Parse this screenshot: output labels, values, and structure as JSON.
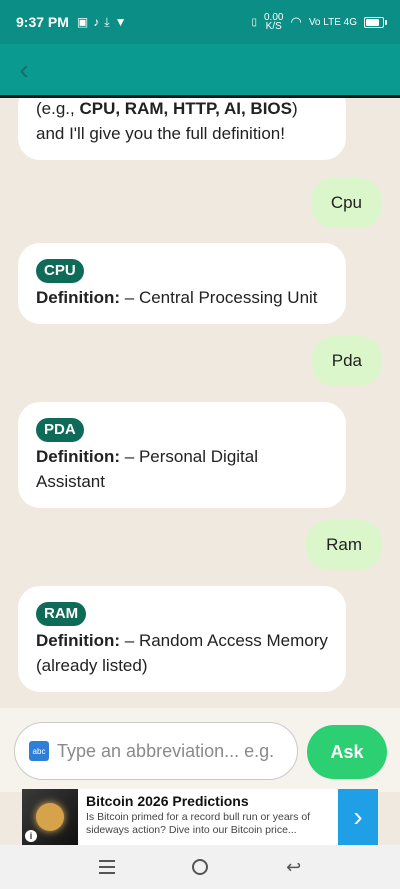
{
  "status_bar": {
    "time": "9:37 PM",
    "left_icons": [
      "sim-card-icon",
      "tiktok-icon",
      "download-done-icon",
      "v-app-icon"
    ],
    "data_speed_value": "0.00",
    "data_speed_unit": "K/S",
    "network": "Vo LTE 4G",
    "battery_level": 0.85
  },
  "app_bar": {
    "back_icon": "chevron-left-icon"
  },
  "messages": [
    {
      "role": "bot",
      "text_prefix": "(e.g., ",
      "text_bold": "CPU, RAM, HTTP, AI, BIOS",
      "text_suffix": ")",
      "text_line2": "and I'll give you the full definition!"
    },
    {
      "role": "user",
      "text": "Cpu"
    },
    {
      "role": "bot",
      "tag": "CPU",
      "def_label": "Definition:",
      "def_text": " – Central Processing Unit"
    },
    {
      "role": "user",
      "text": "Pda"
    },
    {
      "role": "bot",
      "tag": "PDA",
      "def_label": "Definition:",
      "def_text": " – Personal Digital Assistant"
    },
    {
      "role": "user",
      "text": "Ram"
    },
    {
      "role": "bot",
      "tag": "RAM",
      "def_label": "Definition:",
      "def_text": " – Random Access Memory (already listed)"
    }
  ],
  "input": {
    "icon_text": "abc",
    "placeholder": "Type an abbreviation... e.g.",
    "value": ""
  },
  "ask_button": {
    "label": "Ask"
  },
  "ad": {
    "title": "Bitcoin 2026 Predictions",
    "description": "Is Bitcoin primed for a record bull run or years of sideways action? Dive into our Bitcoin price...",
    "info_glyph": "i",
    "arrow_glyph": "›"
  },
  "colors": {
    "header": "#0b9a8f",
    "user_bubble": "#dcf6cc",
    "tag": "#0e6b58",
    "ask_button": "#2ccf72"
  }
}
